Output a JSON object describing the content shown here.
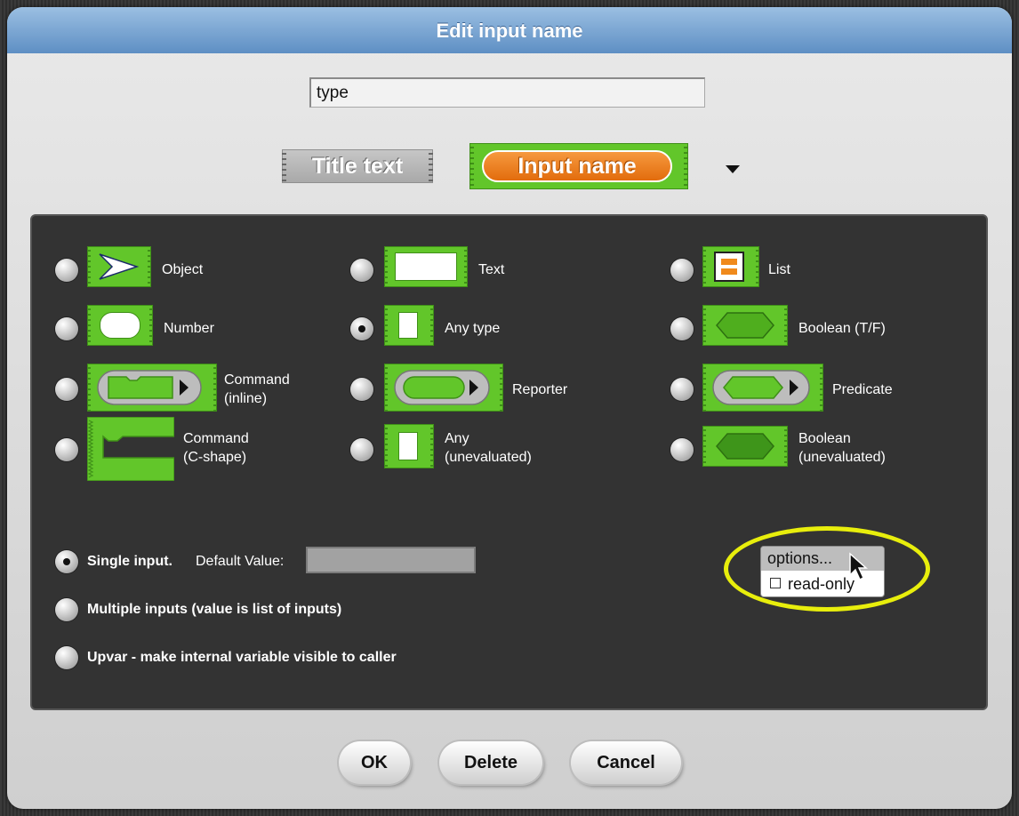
{
  "dialog": {
    "title": "Edit input name",
    "name_value": "type",
    "title_text_label": "Title text",
    "input_name_label": "Input name"
  },
  "types": [
    {
      "label": "Object",
      "selected": false
    },
    {
      "label": "Text",
      "selected": false
    },
    {
      "label": "List",
      "selected": false
    },
    {
      "label": "Number",
      "selected": false
    },
    {
      "label": "Any type",
      "selected": true
    },
    {
      "label": "Boolean (T/F)",
      "selected": false
    },
    {
      "label": "Command\n(inline)",
      "selected": false
    },
    {
      "label": "Reporter",
      "selected": false
    },
    {
      "label": "Predicate",
      "selected": false
    },
    {
      "label": "Command\n(C-shape)",
      "selected": false
    },
    {
      "label": "Any\n(unevaluated)",
      "selected": false
    },
    {
      "label": "Boolean\n(unevaluated)",
      "selected": false
    }
  ],
  "input_modes": {
    "single_label": "Single input.",
    "default_value_label": "Default Value:",
    "default_value": "",
    "multiple_label": "Multiple inputs (value is list of inputs)",
    "upvar_label": "Upvar - make internal variable visible to caller",
    "selected": "single"
  },
  "options_menu": {
    "title": "options...",
    "read_only_label": "read-only",
    "read_only_checked": false
  },
  "buttons": {
    "ok": "OK",
    "delete": "Delete",
    "cancel": "Cancel"
  },
  "colors": {
    "block_green": "#62c62a",
    "title_bar": "#6f9fd2",
    "highlight": "#e8ee0c"
  }
}
